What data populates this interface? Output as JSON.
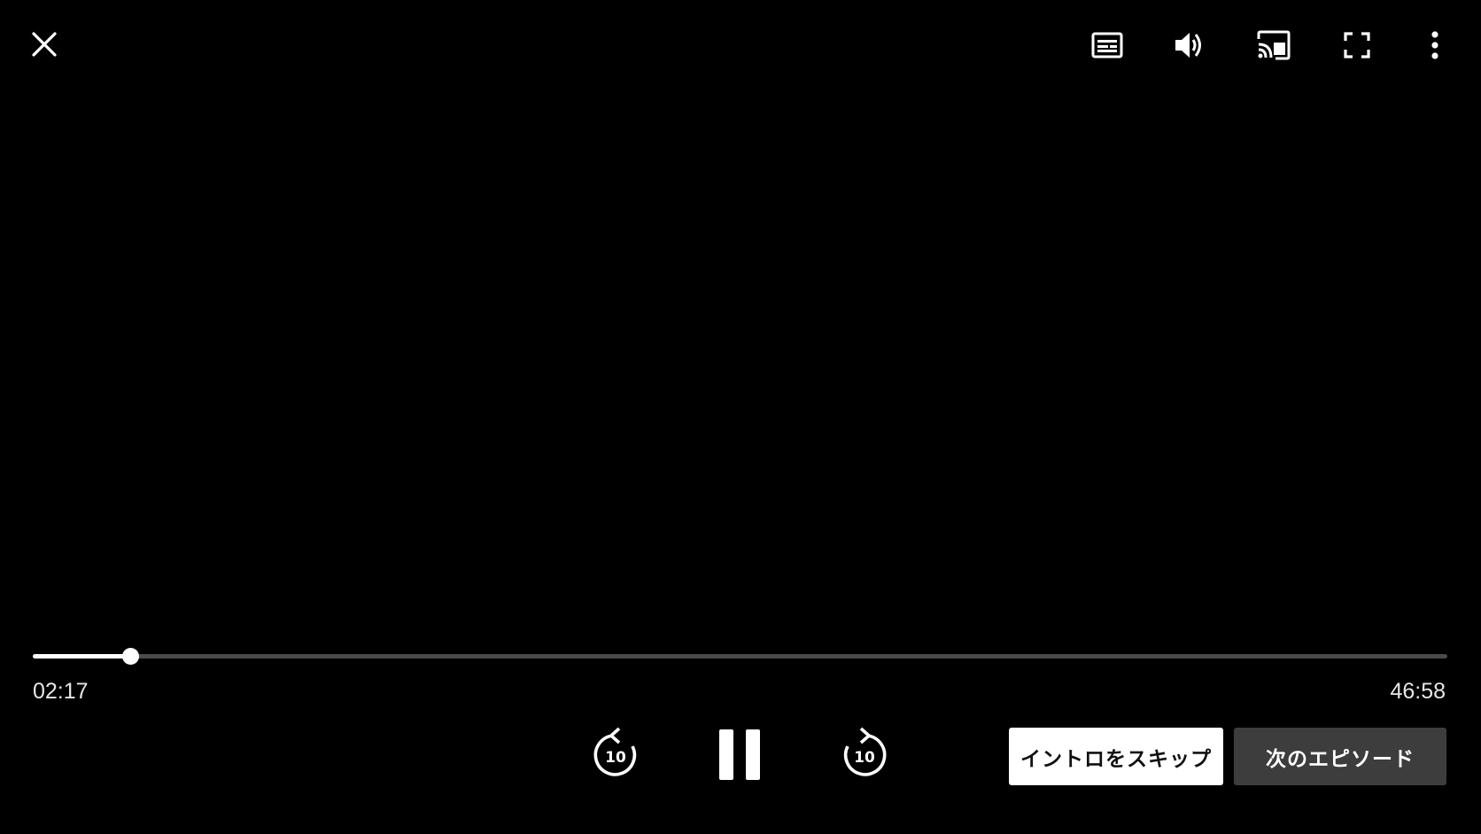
{
  "top_bar": {
    "icons": [
      "close-icon",
      "subtitles-icon",
      "volume-icon",
      "cast-icon",
      "fullscreen-icon",
      "more-vert-icon"
    ]
  },
  "progress": {
    "current_time": "02:17",
    "total_time": "46:58",
    "fraction": 0.0686
  },
  "controls": {
    "rewind_seconds": "10",
    "forward_seconds": "10",
    "state_icon": "pause-icon"
  },
  "actions": {
    "skip_intro_label": "イントロをスキップ",
    "next_episode_label": "次のエピソード"
  },
  "colors": {
    "background": "#000000",
    "progress_fill": "#ffffff",
    "progress_track": "#4a4a4a",
    "skip_button_bg": "#ffffff",
    "next_button_bg": "#3d3d3d"
  }
}
